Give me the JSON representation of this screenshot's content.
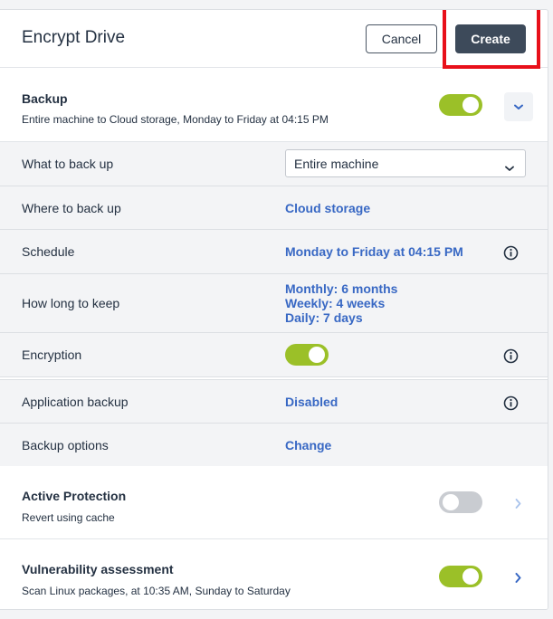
{
  "header": {
    "title": "Encrypt Drive",
    "cancel_label": "Cancel",
    "create_label": "Create"
  },
  "colors": {
    "accent_link": "#3868c4",
    "toggle_on": "#9bc028",
    "toggle_off": "#c9ccd1",
    "primary_button": "#3d4a5a",
    "highlight": "#e8101a"
  },
  "backup": {
    "title": "Backup",
    "summary": "Entire machine to Cloud storage, Monday to Friday at 04:15 PM",
    "enabled": true,
    "expand_icon": "chevron-down-icon"
  },
  "settings": {
    "what_to_back_up": {
      "label": "What to back up",
      "value": "Entire machine"
    },
    "where_to_back_up": {
      "label": "Where to back up",
      "value": "Cloud storage"
    },
    "schedule": {
      "label": "Schedule",
      "value": "Monday to Friday at 04:15 PM",
      "icon": "info-icon"
    },
    "how_long_to_keep": {
      "label": "How long to keep",
      "values": [
        "Monthly: 6 months",
        "Weekly: 4 weeks",
        "Daily: 7 days"
      ]
    },
    "encryption": {
      "label": "Encryption",
      "enabled": true,
      "icon": "info-icon"
    },
    "application_backup": {
      "label": "Application backup",
      "value": "Disabled",
      "icon": "info-icon"
    },
    "backup_options": {
      "label": "Backup options",
      "value": "Change"
    }
  },
  "active_protection": {
    "title": "Active Protection",
    "summary": "Revert using cache",
    "enabled": false,
    "icon": "chevron-right-icon"
  },
  "vulnerability_assessment": {
    "title": "Vulnerability assessment",
    "summary": "Scan Linux packages, at 10:35 AM, Sunday to Saturday",
    "enabled": true,
    "icon": "chevron-right-icon"
  }
}
